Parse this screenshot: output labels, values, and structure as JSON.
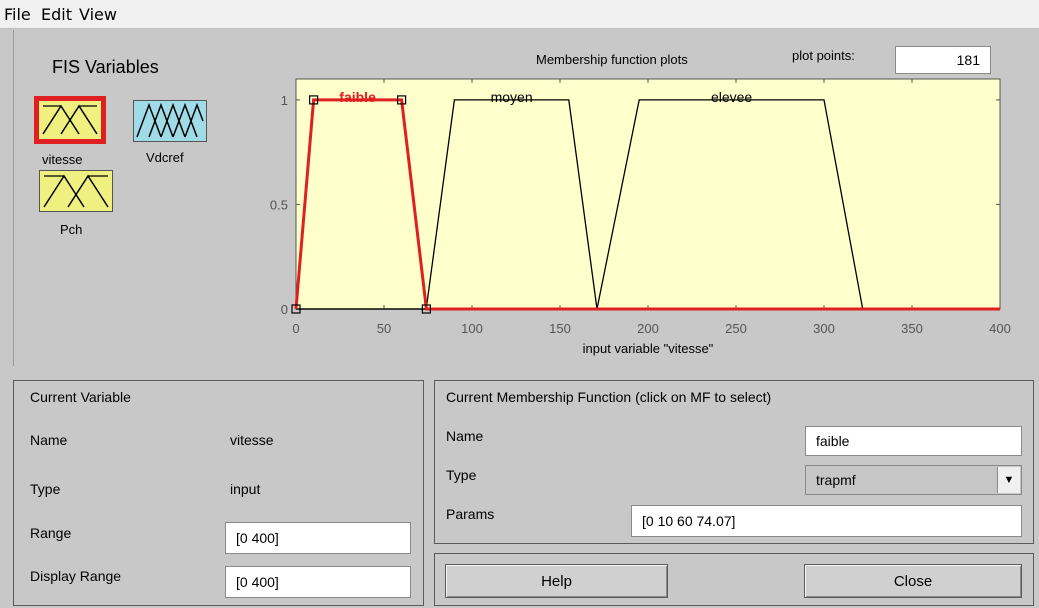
{
  "menu": [
    "File",
    "Edit",
    "View"
  ],
  "fis_variables": {
    "title": "FIS Variables",
    "items": [
      {
        "label": "vitesse",
        "icon": "input-mf-icon",
        "selected": true
      },
      {
        "label": "Vdcref",
        "icon": "output-mf-icon",
        "selected": false
      },
      {
        "label": "Pch",
        "icon": "input-mf-icon",
        "selected": false
      }
    ]
  },
  "plot": {
    "title": "Membership function plots",
    "plot_points_label": "plot points:",
    "plot_points_value": "181"
  },
  "chart_data": {
    "type": "line",
    "xlabel": "input variable \"vitesse\"",
    "xlim": [
      0,
      400
    ],
    "ylim": [
      0,
      1.1
    ],
    "xticks": [
      "0",
      "50",
      "100",
      "150",
      "200",
      "250",
      "300",
      "350",
      "400"
    ],
    "yticks": [
      "0",
      "0.5",
      "1"
    ],
    "series": [
      {
        "name": "faible",
        "type": "trapmf",
        "params": [
          0,
          10,
          60,
          74.07
        ],
        "selected": true,
        "color": "#e02020"
      },
      {
        "name": "moyen",
        "type": "trapmf",
        "params": [
          74,
          90,
          155,
          171
        ],
        "selected": false,
        "color": "#000000"
      },
      {
        "name": "elevee",
        "type": "trapmf",
        "params": [
          171,
          195,
          300,
          322
        ],
        "selected": false,
        "color": "#000000"
      }
    ],
    "background": "#ffffcc"
  },
  "current_variable": {
    "title": "Current Variable",
    "name_label": "Name",
    "name_value": "vitesse",
    "type_label": "Type",
    "type_value": "input",
    "range_label": "Range",
    "range_value": "[0 400]",
    "display_range_label": "Display Range",
    "display_range_value": "[0 400]"
  },
  "current_mf": {
    "title": "Current Membership Function (click on MF to select)",
    "name_label": "Name",
    "name_value": "faible",
    "type_label": "Type",
    "type_value": "trapmf",
    "params_label": "Params",
    "params_value": "[0 10 60 74.07]"
  },
  "buttons": {
    "help": "Help",
    "close": "Close"
  },
  "colors": {
    "selected_border": "#e02020",
    "input_icon_bg": "#f0f080",
    "output_icon_bg": "#a0dce8",
    "plot_bg": "#ffffcc"
  }
}
